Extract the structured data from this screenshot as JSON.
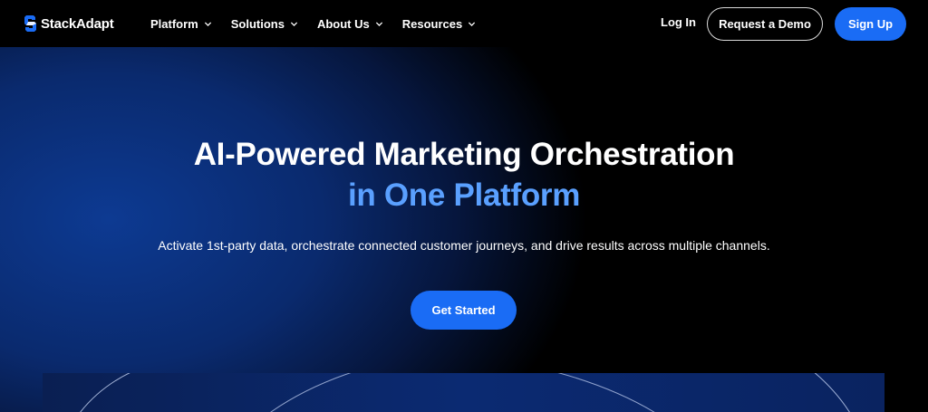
{
  "nav": {
    "brand": "StackAdapt",
    "menu": [
      {
        "label": "Platform"
      },
      {
        "label": "Solutions"
      },
      {
        "label": "About Us"
      },
      {
        "label": "Resources"
      }
    ],
    "login_label": "Log In",
    "demo_label": "Request a Demo",
    "signup_label": "Sign Up"
  },
  "hero": {
    "title_line1": "AI-Powered Marketing Orchestration",
    "title_line2": "in One Platform",
    "subtitle": "Activate 1st-party data, orchestrate connected customer journeys, and drive results across multiple channels.",
    "cta_label": "Get Started"
  },
  "colors": {
    "accent_blue": "#1a6cf5",
    "title_accent": "#5aa0ff",
    "background": "#000000",
    "hero_glow": "#0d3a92"
  },
  "icons": {
    "logo": "stackadapt-logo-icon",
    "menu_chevron": "chevron-down-icon"
  }
}
